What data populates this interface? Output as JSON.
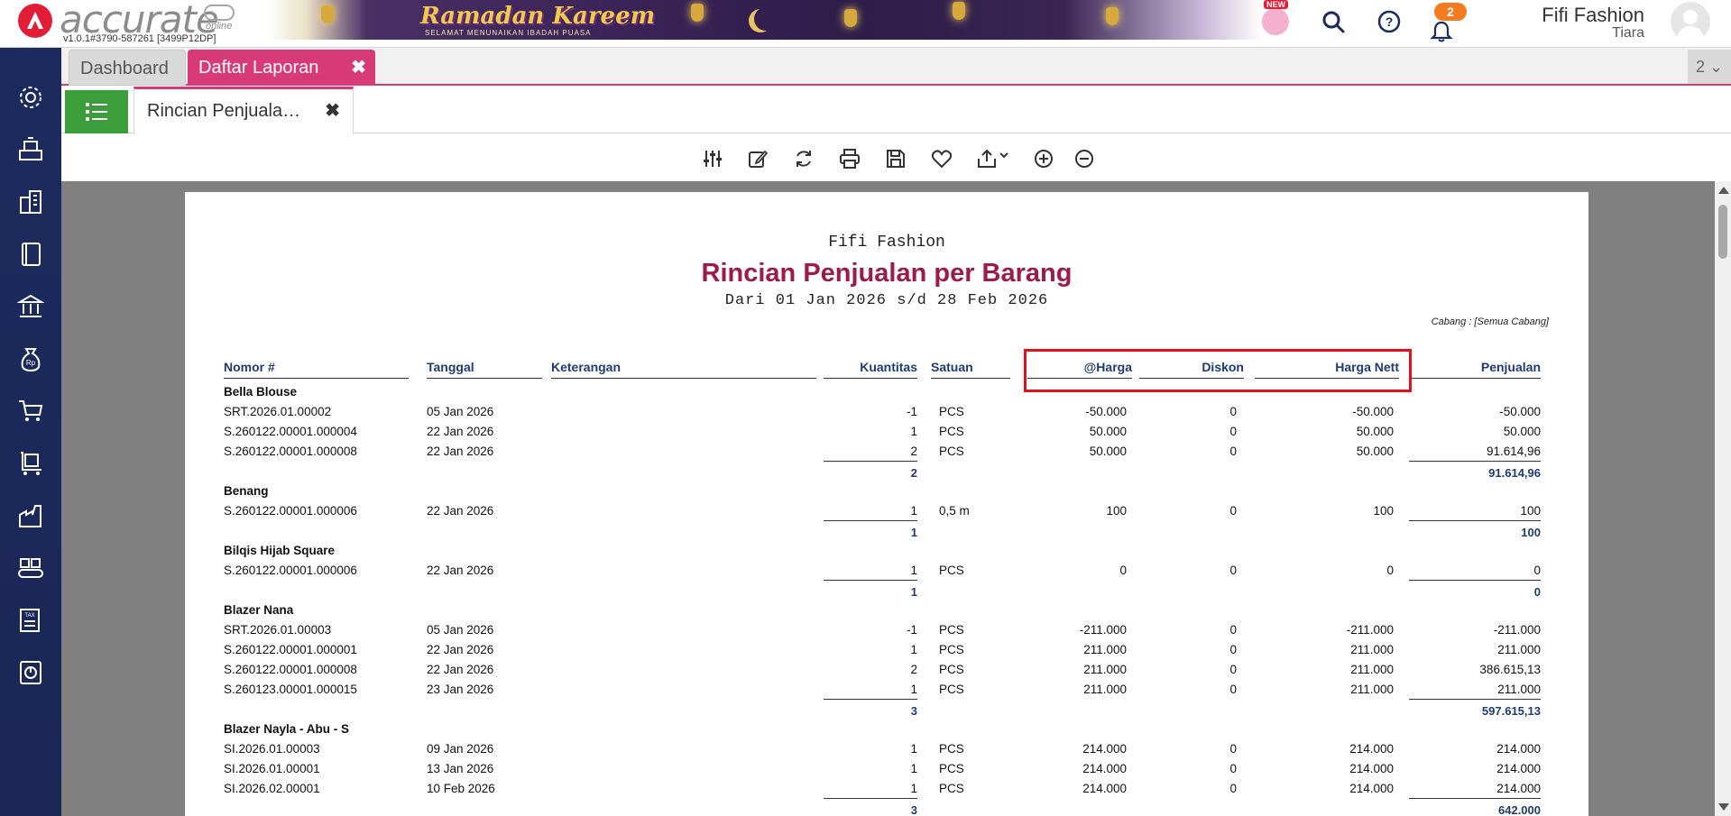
{
  "app": {
    "logo_text": "accurate",
    "logo_sub": "online",
    "version": "v1.0.1#3790-587261 [3499P12DP]",
    "banner_title": "Ramadan Kareem",
    "banner_subtitle": "SELAMAT MENUNAIKAN IBADAH PUASA",
    "new_badge": "NEW",
    "notification_count": "2",
    "company": "Fifi Fashion",
    "user": "Tiara"
  },
  "tabs": {
    "dashboard": "Dashboard",
    "laporan": "Daftar Laporan",
    "close": "✖",
    "count": "2 ⌄"
  },
  "subtab": {
    "label": "Rincian Penjuala…",
    "close": "✖"
  },
  "report": {
    "company": "Fifi Fashion",
    "title": "Rincian Penjualan per Barang",
    "period": "Dari 01 Jan 2026 s/d 28 Feb 2026",
    "branch": "Cabang : [Semua Cabang]",
    "headers": {
      "nomor": "Nomor #",
      "tanggal": "Tanggal",
      "keterangan": "Keterangan",
      "kuantitas": "Kuantitas",
      "satuan": "Satuan",
      "harga": "@Harga",
      "diskon": "Diskon",
      "harga_nett": "Harga Nett",
      "penjualan": "Penjualan"
    },
    "groups": [
      {
        "name": "Bella Blouse",
        "rows": [
          {
            "no": "SRT.2026.01.00002",
            "date": "05 Jan 2026",
            "qty": "-1",
            "unit": "PCS",
            "price": "-50.000",
            "disc": "0",
            "nett": "-50.000",
            "sales": "-50.000"
          },
          {
            "no": "S.260122.00001.000004",
            "date": "22 Jan 2026",
            "qty": "1",
            "unit": "PCS",
            "price": "50.000",
            "disc": "0",
            "nett": "50.000",
            "sales": "50.000"
          },
          {
            "no": "S.260122.00001.000008",
            "date": "22 Jan 2026",
            "qty": "2",
            "unit": "PCS",
            "price": "50.000",
            "disc": "0",
            "nett": "50.000",
            "sales": "91.614,96"
          }
        ],
        "total_qty": "2",
        "total_sales": "91.614,96"
      },
      {
        "name": "Benang",
        "rows": [
          {
            "no": "S.260122.00001.000006",
            "date": "22 Jan 2026",
            "qty": "1",
            "unit": "0,5 m",
            "price": "100",
            "disc": "0",
            "nett": "100",
            "sales": "100"
          }
        ],
        "total_qty": "1",
        "total_sales": "100"
      },
      {
        "name": "Bilqis Hijab Square",
        "rows": [
          {
            "no": "S.260122.00001.000006",
            "date": "22 Jan 2026",
            "qty": "1",
            "unit": "PCS",
            "price": "0",
            "disc": "0",
            "nett": "0",
            "sales": "0"
          }
        ],
        "total_qty": "1",
        "total_sales": "0"
      },
      {
        "name": "Blazer Nana",
        "rows": [
          {
            "no": "SRT.2026.01.00003",
            "date": "05 Jan 2026",
            "qty": "-1",
            "unit": "PCS",
            "price": "-211.000",
            "disc": "0",
            "nett": "-211.000",
            "sales": "-211.000"
          },
          {
            "no": "S.260122.00001.000001",
            "date": "22 Jan 2026",
            "qty": "1",
            "unit": "PCS",
            "price": "211.000",
            "disc": "0",
            "nett": "211.000",
            "sales": "211.000"
          },
          {
            "no": "S.260122.00001.000008",
            "date": "22 Jan 2026",
            "qty": "2",
            "unit": "PCS",
            "price": "211.000",
            "disc": "0",
            "nett": "211.000",
            "sales": "386.615,13"
          },
          {
            "no": "S.260123.00001.000015",
            "date": "23 Jan 2026",
            "qty": "1",
            "unit": "PCS",
            "price": "211.000",
            "disc": "0",
            "nett": "211.000",
            "sales": "211.000"
          }
        ],
        "total_qty": "3",
        "total_sales": "597.615,13"
      },
      {
        "name": "Blazer Nayla - Abu - S",
        "rows": [
          {
            "no": "SI.2026.01.00003",
            "date": "09 Jan 2026",
            "qty": "1",
            "unit": "PCS",
            "price": "214.000",
            "disc": "0",
            "nett": "214.000",
            "sales": "214.000"
          },
          {
            "no": "SI.2026.01.00001",
            "date": "13 Jan 2026",
            "qty": "1",
            "unit": "PCS",
            "price": "214.000",
            "disc": "0",
            "nett": "214.000",
            "sales": "214.000"
          },
          {
            "no": "SI.2026.02.00001",
            "date": "10 Feb 2026",
            "qty": "1",
            "unit": "PCS",
            "price": "214.000",
            "disc": "0",
            "nett": "214.000",
            "sales": "214.000"
          }
        ],
        "total_qty": "3",
        "total_sales": "642.000"
      }
    ]
  },
  "colors": {
    "accent": "#d83a78",
    "report_title": "#9b1b4a",
    "header_text": "#1f3b70",
    "sidebar": "#1c2b5e",
    "highlight": "#e0101c"
  },
  "icons": {
    "sidebar": [
      "gear-icon",
      "cash-register-icon",
      "building-icon",
      "book-icon",
      "bank-icon",
      "money-bag-icon",
      "cart-icon",
      "trolley-icon",
      "factory-icon",
      "conveyor-icon",
      "tax-icon",
      "report-chart-icon"
    ],
    "toolbar": [
      "filter-sliders-icon",
      "edit-icon",
      "refresh-icon",
      "print-icon",
      "save-icon",
      "favorite-icon",
      "export-icon",
      "zoom-in-icon",
      "zoom-out-icon"
    ]
  }
}
